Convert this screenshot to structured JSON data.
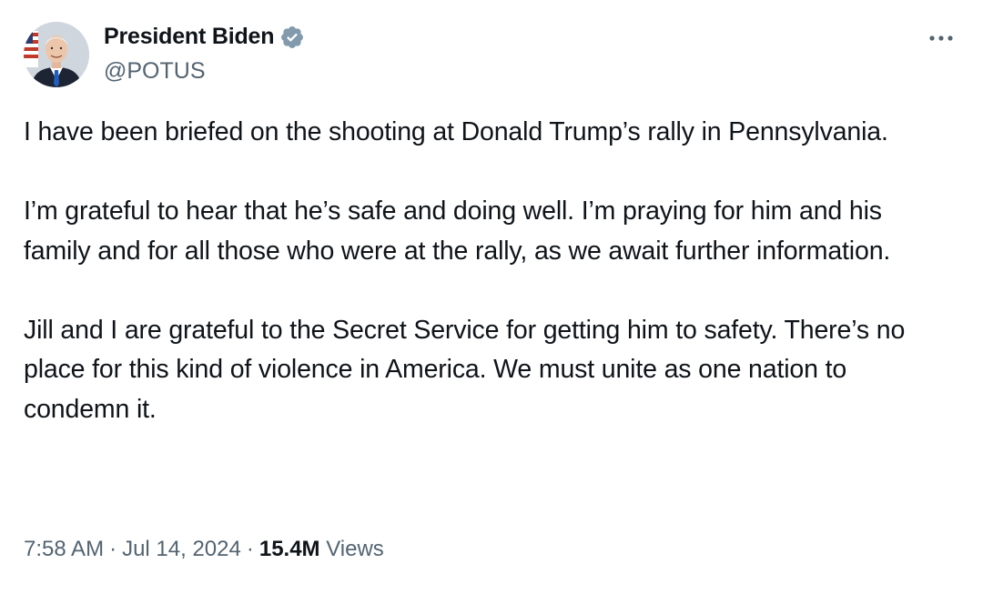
{
  "author": {
    "display_name": "President Biden",
    "handle": "@POTUS",
    "avatar_icon": "portrait-avatar",
    "verified_icon": "verified-badge-icon",
    "verified_color": "#829aab"
  },
  "actions": {
    "more_icon": "more-options-icon"
  },
  "tweet": {
    "paragraphs": [
      "I have been briefed on the shooting at Donald Trump’s rally in Pennsylvania.",
      "I’m grateful to hear that he’s safe and doing well. I’m praying for him and his family and for all those who were at the rally, as we await further information.",
      "Jill and I are grateful to the Secret Service for getting him to safety. There’s no place for this kind of violence in America. We must unite as one nation to condemn it."
    ]
  },
  "meta": {
    "time": "7:58 AM",
    "separator": "·",
    "date": "Jul 14, 2024",
    "views_count": "15.4M",
    "views_label": "Views"
  },
  "colors": {
    "text_primary": "#0f1419",
    "text_secondary": "#536471"
  }
}
